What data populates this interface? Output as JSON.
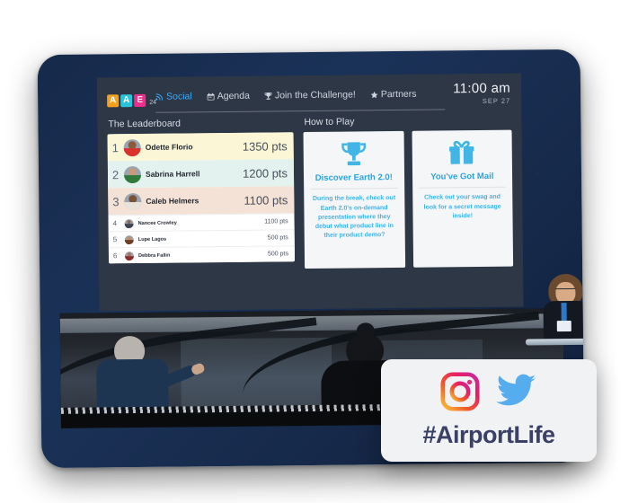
{
  "app": {
    "logo": {
      "letters": [
        "A",
        "A",
        "E"
      ],
      "year": "24"
    },
    "nav": [
      {
        "label": "Social",
        "icon": "rss-icon",
        "active": true
      },
      {
        "label": "Agenda",
        "icon": "calendar-icon",
        "active": false
      },
      {
        "label": "Join the Challenge!",
        "icon": "trophy-icon",
        "active": false
      },
      {
        "label": "Partners",
        "icon": "star-icon",
        "active": false
      }
    ],
    "clock": {
      "time": "11:00 am",
      "date": "SEP 27"
    }
  },
  "leaderboard": {
    "title": "The Leaderboard",
    "rows": [
      {
        "rank": "1",
        "name": "Odette Florio",
        "points": "1350 pts"
      },
      {
        "rank": "2",
        "name": "Sabrina Harrell",
        "points": "1200 pts"
      },
      {
        "rank": "3",
        "name": "Caleb Helmers",
        "points": "1100 pts"
      },
      {
        "rank": "4",
        "name": "Nancee Crowley",
        "points": "1100 pts"
      },
      {
        "rank": "5",
        "name": "Lupe Lagos",
        "points": "500 pts"
      },
      {
        "rank": "6",
        "name": "Debbra Fallin",
        "points": "500 pts"
      }
    ]
  },
  "how_to_play": {
    "title": "How to Play",
    "cards": [
      {
        "icon": "trophy-icon",
        "title": "Discover Earth 2.0!",
        "body": "During the break, check out Earth 2.0's on-demand presentation where they debut what product line in their product demo?"
      },
      {
        "icon": "gift-icon",
        "title": "You've Got Mail",
        "body": "Check out your swag and look for a secret message inside!"
      }
    ]
  },
  "hashtag_card": {
    "instagram_icon": "instagram-icon",
    "twitter_icon": "twitter-icon",
    "hashtag": "#AirportLife"
  },
  "colors": {
    "frame_navy": "#1b3258",
    "screen_slate": "#2e3746",
    "accent_blue": "#3fa9f5",
    "card_title_blue": "#2aa3e0",
    "logo_orange": "#f5a11d",
    "logo_cyan": "#2bc4dd",
    "logo_magenta": "#ee2d8d",
    "rank1_bg": "#fbf6d5",
    "rank2_bg": "#e3f2ee",
    "rank3_bg": "#f4e2d6",
    "hashtag_navy": "#3a4066"
  }
}
